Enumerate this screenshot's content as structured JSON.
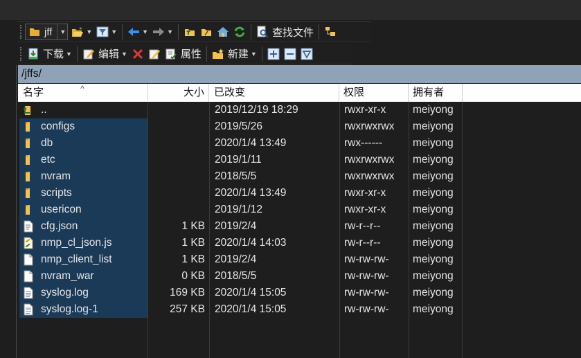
{
  "toolbar1": {
    "drive_label": "jff",
    "find_label": "查找文件",
    "icons": [
      "folder-icon",
      "open-folder-icon",
      "filter-icon",
      "back-arrow-icon",
      "forward-arrow-icon",
      "parent-folder-icon",
      "root-folder-icon",
      "home-icon",
      "refresh-icon",
      "find-files-icon",
      "tree-icon"
    ]
  },
  "toolbar2": {
    "download_label": "下载",
    "edit_label": "编辑",
    "properties_label": "属性",
    "new_label": "新建",
    "icons": [
      "download-icon",
      "edit-icon",
      "delete-icon",
      "rename-icon",
      "properties-icon",
      "new-icon",
      "plus-icon",
      "minus-icon",
      "filter-icon"
    ]
  },
  "path": "/jffs/",
  "columns": {
    "name": "名字",
    "size": "大小",
    "changed": "已改变",
    "rights": "权限",
    "owner": "拥有者"
  },
  "colors": {
    "path_bar": "#8fa2b8",
    "selection": "#1b3a58",
    "folder": "#f2c14e",
    "background": "#1e1e1e"
  },
  "files": [
    {
      "name": "..",
      "size": "",
      "changed": "2019/12/19 18:29",
      "rights": "rwxr-xr-x",
      "owner": "meiyong",
      "icon": "parent-directory-icon"
    },
    {
      "name": "configs",
      "size": "",
      "changed": "2019/5/26",
      "rights": "rwxrwxrwx",
      "owner": "meiyong",
      "icon": "folder-icon"
    },
    {
      "name": "db",
      "size": "",
      "changed": "2020/1/4 13:49",
      "rights": "rwx------",
      "owner": "meiyong",
      "icon": "folder-icon"
    },
    {
      "name": "etc",
      "size": "",
      "changed": "2019/1/11",
      "rights": "rwxrwxrwx",
      "owner": "meiyong",
      "icon": "folder-icon"
    },
    {
      "name": "nvram",
      "size": "",
      "changed": "2018/5/5",
      "rights": "rwxrwxrwx",
      "owner": "meiyong",
      "icon": "folder-icon"
    },
    {
      "name": "scripts",
      "size": "",
      "changed": "2020/1/4 13:49",
      "rights": "rwxr-xr-x",
      "owner": "meiyong",
      "icon": "folder-icon"
    },
    {
      "name": "usericon",
      "size": "",
      "changed": "2019/1/12",
      "rights": "rwxr-xr-x",
      "owner": "meiyong",
      "icon": "folder-icon"
    },
    {
      "name": "cfg.json",
      "size": "1 KB",
      "changed": "2019/2/4",
      "rights": "rw-r--r--",
      "owner": "meiyong",
      "icon": "json-file-icon"
    },
    {
      "name": "nmp_cl_json.js",
      "size": "1 KB",
      "changed": "2020/1/4 14:03",
      "rights": "rw-r--r--",
      "owner": "meiyong",
      "icon": "script-file-icon"
    },
    {
      "name": "nmp_client_list",
      "size": "1 KB",
      "changed": "2019/2/4",
      "rights": "rw-rw-rw-",
      "owner": "meiyong",
      "icon": "file-icon"
    },
    {
      "name": "nvram_war",
      "size": "0 KB",
      "changed": "2018/5/5",
      "rights": "rw-rw-rw-",
      "owner": "meiyong",
      "icon": "file-icon"
    },
    {
      "name": "syslog.log",
      "size": "169 KB",
      "changed": "2020/1/4 15:05",
      "rights": "rw-rw-rw-",
      "owner": "meiyong",
      "icon": "text-file-icon"
    },
    {
      "name": "syslog.log-1",
      "size": "257 KB",
      "changed": "2020/1/4 15:05",
      "rights": "rw-rw-rw-",
      "owner": "meiyong",
      "icon": "text-file-icon"
    }
  ]
}
